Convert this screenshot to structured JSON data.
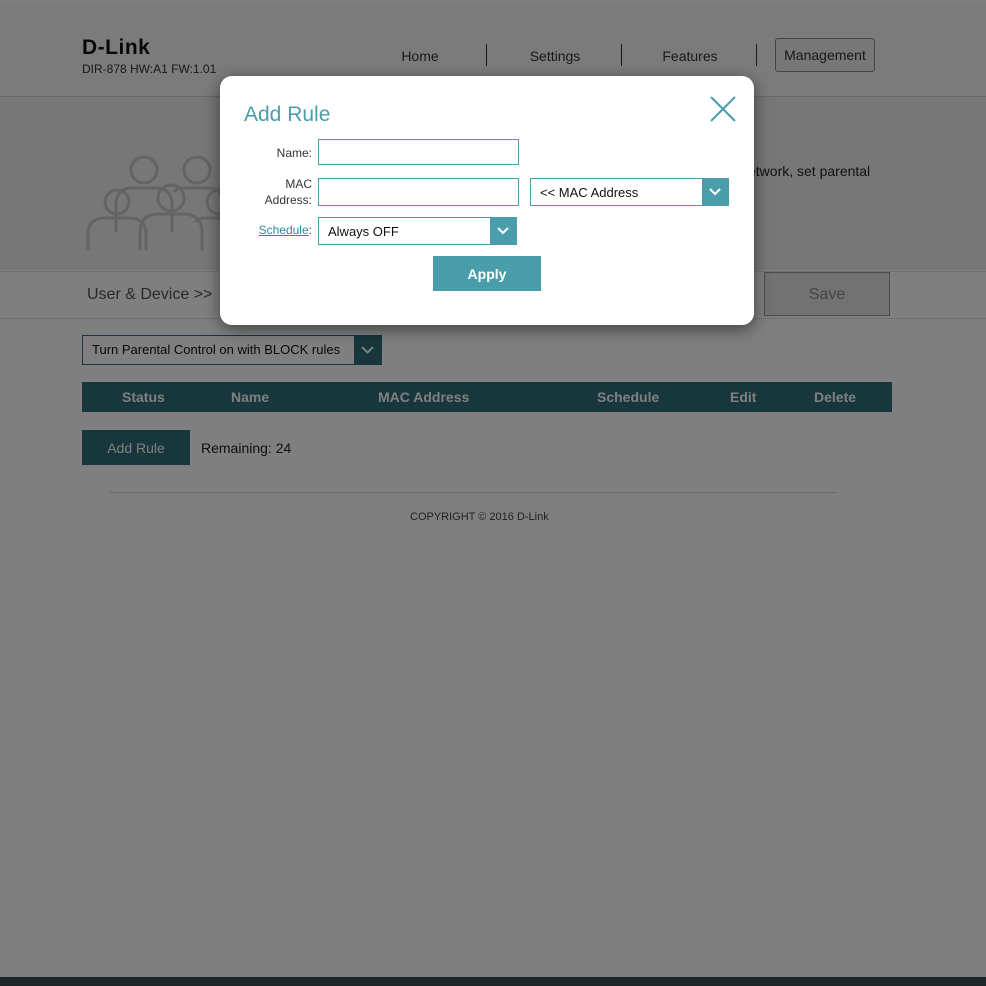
{
  "header": {
    "brand": "D-Link",
    "model_info": "DIR-878 HW:A1 FW:1.01",
    "nav": [
      {
        "label": "Home"
      },
      {
        "label": "Settings"
      },
      {
        "label": "Features"
      },
      {
        "label": "Management",
        "active": true
      }
    ]
  },
  "hero": {
    "description_fragment": "etwork, set parental"
  },
  "breadcrumb": {
    "text": "User & Device >> ",
    "save_label": "Save"
  },
  "parental_control": {
    "mode_selected": "Turn Parental Control on with BLOCK rules"
  },
  "rules_table": {
    "columns": [
      "Status",
      "Name",
      "MAC Address",
      "Schedule",
      "Edit",
      "Delete"
    ],
    "add_rule_label": "Add Rule",
    "remaining_text": "Remaining: 24"
  },
  "footer": {
    "copyright": "COPYRIGHT © 2016 D-Link"
  },
  "modal": {
    "title": "Add Rule",
    "name_label": "Name:",
    "name_value": "",
    "mac_label_line1": "MAC",
    "mac_label_line2": "Address:",
    "mac_value": "",
    "mac_dropdown_selected": "<< MAC Address",
    "schedule_label": "Schedule",
    "schedule_colon": ":",
    "schedule_selected": "Always OFF",
    "apply_label": "Apply"
  },
  "colors": {
    "accent_dark": "#2e6f7a",
    "accent_light": "#4a9eac"
  },
  "icons": {
    "close": "close-icon",
    "dropdown": "chevron-down-icon",
    "hero": "users-group-icon"
  }
}
